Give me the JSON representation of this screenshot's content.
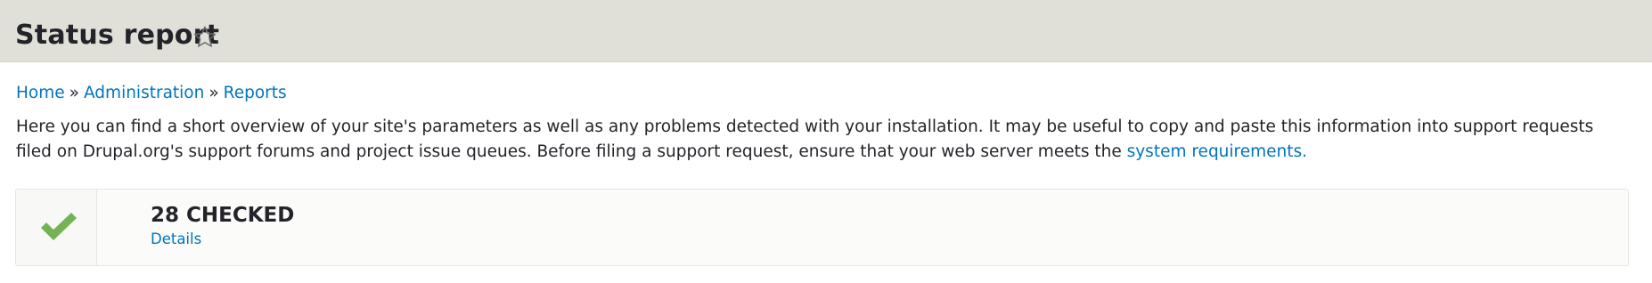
{
  "header": {
    "title": "Status report",
    "star_icon": "star-outline-icon"
  },
  "breadcrumb": {
    "items": [
      "Home",
      "Administration",
      "Reports"
    ],
    "separator": "»"
  },
  "description": {
    "text_before_link": "Here you can find a short overview of your site's parameters as well as any problems detected with your installation. It may be useful to copy and paste this information into support requests filed on Drupal.org's support forums and project issue queues. Before filing a support request, ensure that your web server meets the ",
    "link_text": "system requirements."
  },
  "status": {
    "icon": "checkmark-icon",
    "count_label": "28 CHECKED",
    "details_label": "Details",
    "icon_color": "#73b355"
  },
  "colors": {
    "header_bg": "#e0e0d8",
    "link": "#0074bd",
    "text": "#232429"
  }
}
